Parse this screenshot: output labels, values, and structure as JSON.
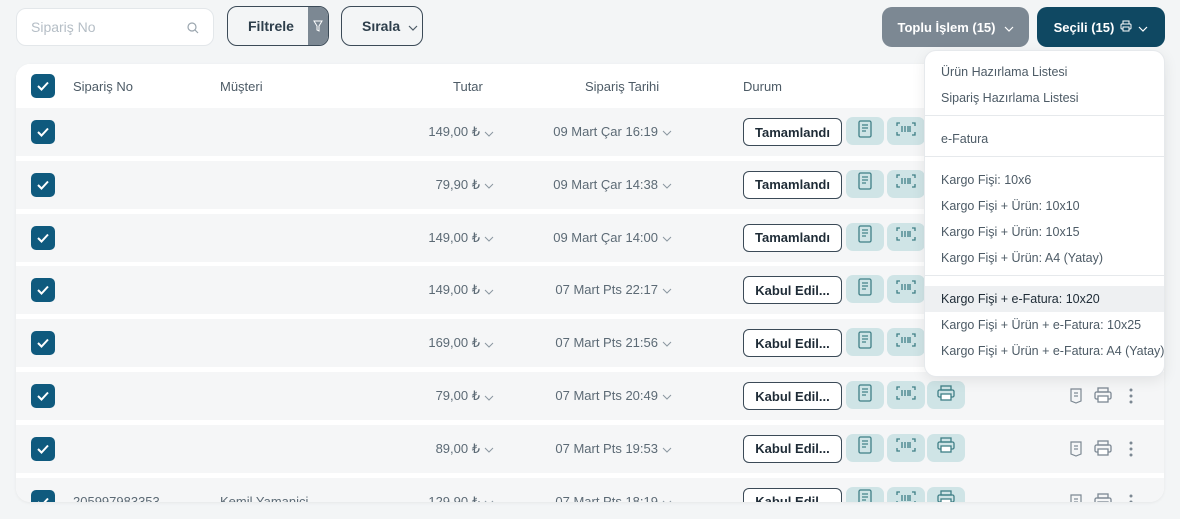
{
  "search": {
    "placeholder": "Sipariş No",
    "icon": "search-icon"
  },
  "toolbar": {
    "filter_label": "Filtrele",
    "sort_label": "Sırala",
    "bulk_label": "Toplu İşlem (15)",
    "selected_label": "Seçili (15)"
  },
  "table": {
    "headers": {
      "order_no": "Sipariş No",
      "customer": "Müşteri",
      "amount": "Tutar",
      "date": "Sipariş Tarihi",
      "status": "Durum"
    },
    "rows": [
      {
        "order_no": "",
        "customer": "",
        "amount": "149,00 ₺",
        "date": "09 Mart Çar 16:19",
        "status": "Tamamlandı",
        "print": false
      },
      {
        "order_no": "",
        "customer": "",
        "amount": "79,90 ₺",
        "date": "09 Mart Çar 14:38",
        "status": "Tamamlandı",
        "print": false
      },
      {
        "order_no": "",
        "customer": "",
        "amount": "149,00 ₺",
        "date": "09 Mart Çar 14:00",
        "status": "Tamamlandı",
        "print": false
      },
      {
        "order_no": "",
        "customer": "",
        "amount": "149,00 ₺",
        "date": "07 Mart Pts 22:17",
        "status": "Kabul Edil...",
        "print": false
      },
      {
        "order_no": "",
        "customer": "",
        "amount": "169,00 ₺",
        "date": "07 Mart Pts 21:56",
        "status": "Kabul Edil...",
        "print": false
      },
      {
        "order_no": "",
        "customer": "",
        "amount": "79,00 ₺",
        "date": "07 Mart Pts 20:49",
        "status": "Kabul Edil...",
        "print": true
      },
      {
        "order_no": "",
        "customer": "",
        "amount": "89,00 ₺",
        "date": "07 Mart Pts 19:53",
        "status": "Kabul Edil...",
        "print": true
      },
      {
        "order_no": "205997983353",
        "customer": "Kemil Yamaniçi",
        "amount": "129,90 ₺",
        "date": "07 Mart Pts 18:19",
        "status": "Kabul Edil...",
        "print": true
      }
    ]
  },
  "dropdown": {
    "groups": [
      [
        "Ürün Hazırlama Listesi",
        "Sipariş Hazırlama Listesi"
      ],
      [
        "e-Fatura"
      ],
      [
        "Kargo Fişi: 10x6",
        "Kargo Fişi + Ürün: 10x10",
        "Kargo Fişi + Ürün: 10x15",
        "Kargo Fişi + Ürün: A4 (Yatay)"
      ],
      [
        "Kargo Fişi + e-Fatura: 10x20",
        "Kargo Fişi + Ürün + e-Fatura: 10x25",
        "Kargo Fişi + Ürün + e-Fatura: A4 (Yatay)"
      ]
    ],
    "active_item": "Kargo Fişi + e-Fatura: 10x20"
  },
  "colors": {
    "primary": "#0f4862",
    "checkbox": "#0f5a7e",
    "muted_button": "#7c8893",
    "action_bg": "#cfe4e6"
  }
}
